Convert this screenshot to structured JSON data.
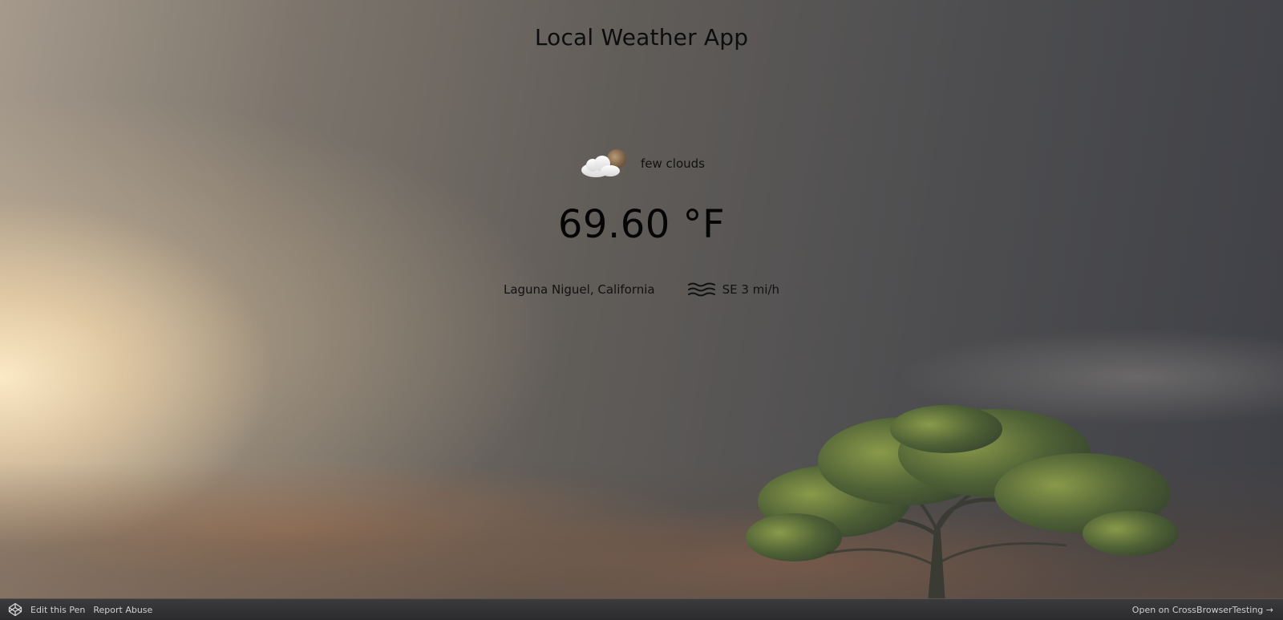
{
  "app": {
    "title": "Local Weather App"
  },
  "weather": {
    "condition": "few clouds",
    "condition_icon": "partly-cloudy-night-icon",
    "temperature": "69.60 °F",
    "location": "Laguna Niguel, California",
    "wind": "SE 3 mi/h",
    "wind_icon": "wind-waves-icon"
  },
  "footer": {
    "edit_label": "Edit this Pen",
    "report_label": "Report Abuse",
    "open_label": "Open on CrossBrowserTesting →",
    "logo_icon": "codepen-logo-icon"
  },
  "colors": {
    "text": "#0a0a0a",
    "footer_bg": "#333335",
    "footer_text": "#cfcfcf"
  }
}
